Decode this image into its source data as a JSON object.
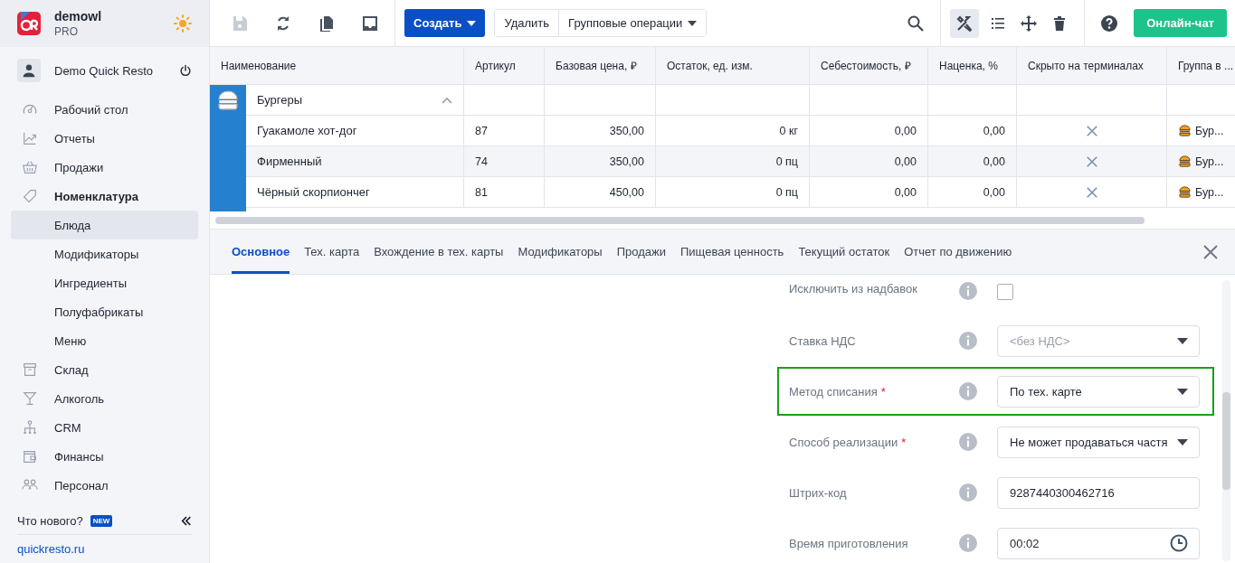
{
  "app": {
    "name": "demowl",
    "plan": "PRO"
  },
  "user": {
    "name": "Demo Quick Resto"
  },
  "nav": [
    {
      "label": "Рабочий стол",
      "selected": false
    },
    {
      "label": "Отчеты",
      "selected": false
    },
    {
      "label": "Продажи",
      "selected": false
    },
    {
      "label": "Номенклатура",
      "selected": false,
      "expanded": true,
      "children": [
        {
          "label": "Блюда",
          "selected": true
        },
        {
          "label": "Модификаторы",
          "selected": false
        },
        {
          "label": "Ингредиенты",
          "selected": false
        },
        {
          "label": "Полуфабрикаты",
          "selected": false
        },
        {
          "label": "Меню",
          "selected": false
        }
      ]
    },
    {
      "label": "Склад",
      "selected": false
    },
    {
      "label": "Алкоголь",
      "selected": false
    },
    {
      "label": "CRM",
      "selected": false
    },
    {
      "label": "Финансы",
      "selected": false
    },
    {
      "label": "Персонал",
      "selected": false
    }
  ],
  "whats_new": {
    "label": "Что нового?",
    "badge": "NEW"
  },
  "site_link": "quickresto.ru",
  "toolbar": {
    "save_disabled": true,
    "create": "Создать",
    "delete": "Удалить",
    "group_ops": "Групповые операции",
    "tools_selected": true,
    "chat": "Онлайн-чат"
  },
  "table": {
    "columns": [
      "Наименование",
      "Артикул",
      "Базовая цена, ₽",
      "Остаток, ед. изм.",
      "Себестоимость, ₽",
      "Наценка, %",
      "Скрыто на терминалах",
      "Группа в ..."
    ],
    "group": {
      "name": "Бургеры",
      "expanded": true
    },
    "rows": [
      {
        "name": "Гуакамоле хот-дог",
        "article": "87",
        "price": "350,00",
        "stock": "0 кг",
        "cost": "0,00",
        "markup": "0,00",
        "hidden_on_terminals": false,
        "group": "Бур...",
        "selected": false
      },
      {
        "name": "Фирменный",
        "article": "74",
        "price": "350,00",
        "stock": "0 пц",
        "cost": "0,00",
        "markup": "0,00",
        "hidden_on_terminals": false,
        "group": "Бур...",
        "selected": true
      },
      {
        "name": "Чёрный скорпиончег",
        "article": "81",
        "price": "450,00",
        "stock": "0 пц",
        "cost": "0,00",
        "markup": "0,00",
        "hidden_on_terminals": false,
        "group": "Бур...",
        "selected": false
      }
    ]
  },
  "tabs": [
    {
      "label": "Основное",
      "selected": true
    },
    {
      "label": "Тех. карта",
      "selected": false
    },
    {
      "label": "Вхождение в тех. карты",
      "selected": false
    },
    {
      "label": "Модификаторы",
      "selected": false
    },
    {
      "label": "Продажи",
      "selected": false
    },
    {
      "label": "Пищевая ценность",
      "selected": false
    },
    {
      "label": "Текущий остаток",
      "selected": false
    },
    {
      "label": "Отчет по движению",
      "selected": false
    }
  ],
  "form": [
    {
      "kind": "checkbox",
      "label": "Исключить из надбавок",
      "checked": false,
      "highlighted": false
    },
    {
      "kind": "select",
      "label": "Ставка НДС",
      "placeholder": "<без НДС>",
      "highlighted": false
    },
    {
      "kind": "select",
      "label": "Метод списания",
      "required_mark": "*",
      "value": "По тех. карте",
      "highlighted": true
    },
    {
      "kind": "select",
      "label": "Способ реализации",
      "required_mark": "*",
      "value": "Не может продаваться частя",
      "highlighted": false
    },
    {
      "kind": "text",
      "label": "Штрих-код",
      "value": "9287440300462716",
      "highlighted": false
    },
    {
      "kind": "time",
      "label": "Время приготовления",
      "value": "00:02",
      "highlighted": false
    }
  ]
}
